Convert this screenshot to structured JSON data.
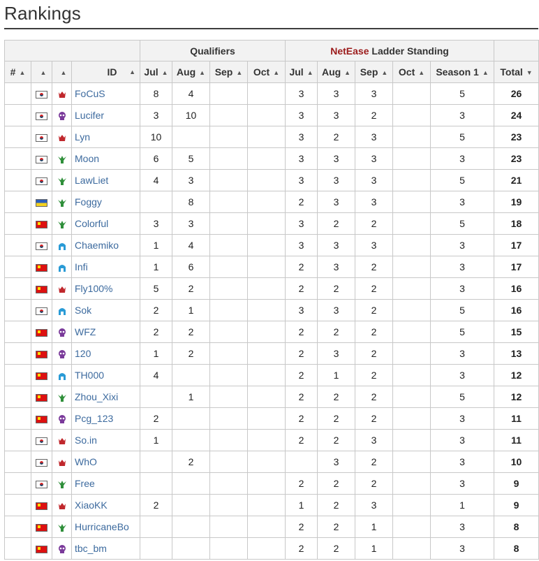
{
  "title": "Rankings",
  "header": {
    "group_qualifiers": "Qualifiers",
    "group_netease": "NetEase",
    "group_ladder_rest": " Ladder Standing",
    "col_rank": "#",
    "col_id": "ID",
    "q_months": [
      "Jul",
      "Aug",
      "Sep",
      "Oct"
    ],
    "l_months": [
      "Jul",
      "Aug",
      "Sep",
      "Oct"
    ],
    "col_season": "Season 1",
    "col_total": "Total"
  },
  "colors": {
    "human": "#c0282d",
    "undead": "#7a3a9a",
    "nightelf": "#2f8f3a",
    "orc": "#2a9bd6"
  },
  "rows": [
    {
      "flag": "kr",
      "race": "human",
      "id": "FoCuS",
      "q": [
        "8",
        "4",
        "",
        ""
      ],
      "l": [
        "3",
        "3",
        "3",
        ""
      ],
      "s1": "5",
      "total": "26"
    },
    {
      "flag": "kr",
      "race": "undead",
      "id": "Lucifer",
      "q": [
        "3",
        "10",
        "",
        ""
      ],
      "l": [
        "3",
        "3",
        "2",
        ""
      ],
      "s1": "3",
      "total": "24"
    },
    {
      "flag": "kr",
      "race": "human",
      "id": "Lyn",
      "q": [
        "10",
        "",
        "",
        ""
      ],
      "l": [
        "3",
        "2",
        "3",
        ""
      ],
      "s1": "5",
      "total": "23"
    },
    {
      "flag": "kr",
      "race": "nightelf",
      "id": "Moon",
      "q": [
        "6",
        "5",
        "",
        ""
      ],
      "l": [
        "3",
        "3",
        "3",
        ""
      ],
      "s1": "3",
      "total": "23"
    },
    {
      "flag": "kr",
      "race": "nightelf",
      "id": "LawLiet",
      "q": [
        "4",
        "3",
        "",
        ""
      ],
      "l": [
        "3",
        "3",
        "3",
        ""
      ],
      "s1": "5",
      "total": "21"
    },
    {
      "flag": "ua",
      "race": "nightelf",
      "id": "Foggy",
      "q": [
        "",
        "8",
        "",
        ""
      ],
      "l": [
        "2",
        "3",
        "3",
        ""
      ],
      "s1": "3",
      "total": "19"
    },
    {
      "flag": "cn",
      "race": "nightelf",
      "id": "Colorful",
      "q": [
        "3",
        "3",
        "",
        ""
      ],
      "l": [
        "3",
        "2",
        "2",
        ""
      ],
      "s1": "5",
      "total": "18"
    },
    {
      "flag": "kr",
      "race": "orc",
      "id": "Chaemiko",
      "q": [
        "1",
        "4",
        "",
        ""
      ],
      "l": [
        "3",
        "3",
        "3",
        ""
      ],
      "s1": "3",
      "total": "17"
    },
    {
      "flag": "cn",
      "race": "orc",
      "id": "Infi",
      "q": [
        "1",
        "6",
        "",
        ""
      ],
      "l": [
        "2",
        "3",
        "2",
        ""
      ],
      "s1": "3",
      "total": "17"
    },
    {
      "flag": "cn",
      "race": "human",
      "id": "Fly100%",
      "q": [
        "5",
        "2",
        "",
        ""
      ],
      "l": [
        "2",
        "2",
        "2",
        ""
      ],
      "s1": "3",
      "total": "16"
    },
    {
      "flag": "kr",
      "race": "orc",
      "id": "Sok",
      "q": [
        "2",
        "1",
        "",
        ""
      ],
      "l": [
        "3",
        "3",
        "2",
        ""
      ],
      "s1": "5",
      "total": "16"
    },
    {
      "flag": "cn",
      "race": "undead",
      "id": "WFZ",
      "q": [
        "2",
        "2",
        "",
        ""
      ],
      "l": [
        "2",
        "2",
        "2",
        ""
      ],
      "s1": "5",
      "total": "15"
    },
    {
      "flag": "cn",
      "race": "undead",
      "id": "120",
      "q": [
        "1",
        "2",
        "",
        ""
      ],
      "l": [
        "2",
        "3",
        "2",
        ""
      ],
      "s1": "3",
      "total": "13"
    },
    {
      "flag": "cn",
      "race": "orc",
      "id": "TH000",
      "q": [
        "4",
        "",
        "",
        ""
      ],
      "l": [
        "2",
        "1",
        "2",
        ""
      ],
      "s1": "3",
      "total": "12"
    },
    {
      "flag": "cn",
      "race": "nightelf",
      "id": "Zhou_Xixi",
      "q": [
        "",
        "1",
        "",
        ""
      ],
      "l": [
        "2",
        "2",
        "2",
        ""
      ],
      "s1": "5",
      "total": "12"
    },
    {
      "flag": "cn",
      "race": "undead",
      "id": "Pcg_123",
      "q": [
        "2",
        "",
        "",
        ""
      ],
      "l": [
        "2",
        "2",
        "2",
        ""
      ],
      "s1": "3",
      "total": "11"
    },
    {
      "flag": "kr",
      "race": "human",
      "id": "So.in",
      "q": [
        "1",
        "",
        "",
        ""
      ],
      "l": [
        "2",
        "2",
        "3",
        ""
      ],
      "s1": "3",
      "total": "11"
    },
    {
      "flag": "kr",
      "race": "human",
      "id": "WhO",
      "q": [
        "",
        "2",
        "",
        ""
      ],
      "l": [
        "",
        "3",
        "2",
        ""
      ],
      "s1": "3",
      "total": "10"
    },
    {
      "flag": "kr",
      "race": "nightelf",
      "id": "Free",
      "q": [
        "",
        "",
        "",
        ""
      ],
      "l": [
        "2",
        "2",
        "2",
        ""
      ],
      "s1": "3",
      "total": "9"
    },
    {
      "flag": "cn",
      "race": "human",
      "id": "XiaoKK",
      "q": [
        "2",
        "",
        "",
        ""
      ],
      "l": [
        "1",
        "2",
        "3",
        ""
      ],
      "s1": "1",
      "total": "9"
    },
    {
      "flag": "cn",
      "race": "nightelf",
      "id": "HurricaneBo",
      "q": [
        "",
        "",
        "",
        ""
      ],
      "l": [
        "2",
        "2",
        "1",
        ""
      ],
      "s1": "3",
      "total": "8"
    },
    {
      "flag": "cn",
      "race": "undead",
      "id": "tbc_bm",
      "q": [
        "",
        "",
        "",
        ""
      ],
      "l": [
        "2",
        "2",
        "1",
        ""
      ],
      "s1": "3",
      "total": "8"
    }
  ]
}
